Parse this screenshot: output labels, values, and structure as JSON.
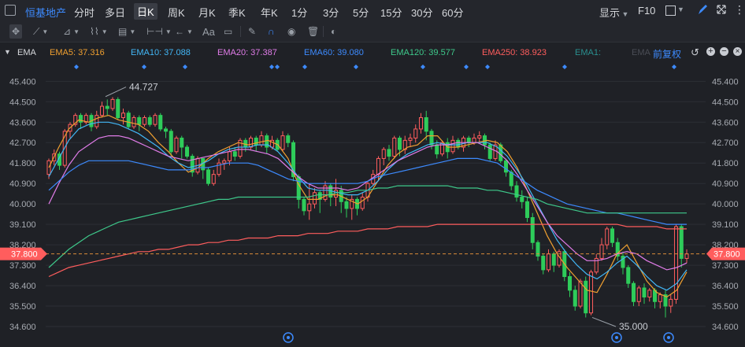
{
  "topbar": {
    "stock_name": "恒基地产",
    "periods": [
      "分时",
      "多日",
      "日K",
      "周K",
      "月K",
      "季K",
      "年K",
      "1分",
      "3分",
      "5分",
      "15分",
      "30分",
      "60分"
    ],
    "active_period": "日K",
    "display_label": "显示",
    "f10_label": "F10"
  },
  "toolbar": {
    "text_tool_label": "Aa"
  },
  "ema": {
    "name": "EMA",
    "items": [
      {
        "label": "EMA5: 37.316",
        "color": "#f0a030"
      },
      {
        "label": "EMA10: 37.088",
        "color": "#42b6f5"
      },
      {
        "label": "EMA20: 37.387",
        "color": "#e07ce8"
      },
      {
        "label": "EMA60: 39.080",
        "color": "#3d8bff"
      },
      {
        "label": "EMA120: 39.577",
        "color": "#3ec98b"
      },
      {
        "label": "EMA250: 38.923",
        "color": "#ff5d5d"
      },
      {
        "label": "EMA1:",
        "color": "#2a8f8f"
      },
      {
        "label": "EMA",
        "color": "#4a4d55"
      }
    ],
    "adjust_label": "前复权"
  },
  "chart_data": {
    "type": "candlestick",
    "ylim": [
      34.15,
      46.0
    ],
    "y_ticks": [
      "45.400",
      "44.500",
      "43.600",
      "42.700",
      "41.800",
      "40.900",
      "40.000",
      "39.100",
      "38.200",
      "37.300",
      "36.400",
      "35.500",
      "34.600"
    ],
    "y_tick_values": [
      45.4,
      44.5,
      43.6,
      42.7,
      41.8,
      40.9,
      40.0,
      39.1,
      38.2,
      37.3,
      36.4,
      35.5,
      34.6
    ],
    "current_price": "37.800",
    "current_price_value": 37.8,
    "high_annotation": "44.727",
    "low_annotation": "35.000",
    "up_color": "#ff5d5d",
    "down_color": "#2ecc5a",
    "candles": [
      [
        41.3,
        41.9,
        41.1,
        42.0
      ],
      [
        41.9,
        42.2,
        41.7,
        42.4
      ],
      [
        42.2,
        41.7,
        41.5,
        42.3
      ],
      [
        41.7,
        43.2,
        41.6,
        43.3
      ],
      [
        43.2,
        43.5,
        42.9,
        43.6
      ],
      [
        43.5,
        43.9,
        43.4,
        44.0
      ],
      [
        43.9,
        43.6,
        43.3,
        44.0
      ],
      [
        43.6,
        43.9,
        43.5,
        44.0
      ],
      [
        43.9,
        43.4,
        43.2,
        44.0
      ],
      [
        43.4,
        43.9,
        43.3,
        44.1
      ],
      [
        43.9,
        44.3,
        43.8,
        44.5
      ],
      [
        44.3,
        44.2,
        43.9,
        44.6
      ],
      [
        44.2,
        44.6,
        44.1,
        44.7
      ],
      [
        44.6,
        43.8,
        43.7,
        44.7
      ],
      [
        43.8,
        44.0,
        43.5,
        44.2
      ],
      [
        44.0,
        43.4,
        43.3,
        44.1
      ],
      [
        43.4,
        43.8,
        43.3,
        43.9
      ],
      [
        43.8,
        43.5,
        43.2,
        43.9
      ],
      [
        43.5,
        43.8,
        43.4,
        43.9
      ],
      [
        43.8,
        43.5,
        43.4,
        43.9
      ],
      [
        43.5,
        43.9,
        43.4,
        44.0
      ],
      [
        43.9,
        43.3,
        43.2,
        44.0
      ],
      [
        43.3,
        43.2,
        42.9,
        43.4
      ],
      [
        43.2,
        42.3,
        42.1,
        43.3
      ],
      [
        42.3,
        42.9,
        42.2,
        43.0
      ],
      [
        42.9,
        42.5,
        42.0,
        43.0
      ],
      [
        42.5,
        42.1,
        42.0,
        42.6
      ],
      [
        42.1,
        41.4,
        41.2,
        42.2
      ],
      [
        41.4,
        42.0,
        41.3,
        42.1
      ],
      [
        42.0,
        41.5,
        41.1,
        42.0
      ],
      [
        41.5,
        40.9,
        40.8,
        41.6
      ],
      [
        40.9,
        41.3,
        40.8,
        41.5
      ],
      [
        41.3,
        41.8,
        41.2,
        42.0
      ],
      [
        41.8,
        41.9,
        41.5,
        42.0
      ],
      [
        41.9,
        42.3,
        41.7,
        42.5
      ],
      [
        42.3,
        42.1,
        41.9,
        42.5
      ],
      [
        42.1,
        42.8,
        42.0,
        42.9
      ],
      [
        42.8,
        42.5,
        42.3,
        42.9
      ],
      [
        42.5,
        42.9,
        42.4,
        43.0
      ],
      [
        42.9,
        42.6,
        42.3,
        43.0
      ],
      [
        42.6,
        43.0,
        42.5,
        43.2
      ],
      [
        43.0,
        42.5,
        42.2,
        43.1
      ],
      [
        42.5,
        42.8,
        42.4,
        43.0
      ],
      [
        42.8,
        42.4,
        42.3,
        42.9
      ],
      [
        42.4,
        43.0,
        42.3,
        43.2
      ],
      [
        43.0,
        42.7,
        42.5,
        43.1
      ],
      [
        42.7,
        41.2,
        41.0,
        42.8
      ],
      [
        41.2,
        40.2,
        39.8,
        41.3
      ],
      [
        40.2,
        39.7,
        39.5,
        40.3
      ],
      [
        39.7,
        40.0,
        39.3,
        40.9
      ],
      [
        40.0,
        40.5,
        39.8,
        40.7
      ],
      [
        40.5,
        40.2,
        39.6,
        40.6
      ],
      [
        40.2,
        40.8,
        40.1,
        41.0
      ],
      [
        40.8,
        40.3,
        39.9,
        40.9
      ],
      [
        40.3,
        40.6,
        39.9,
        41.1
      ],
      [
        40.6,
        40.1,
        39.6,
        40.8
      ],
      [
        40.1,
        39.8,
        39.4,
        40.3
      ],
      [
        39.8,
        40.2,
        39.3,
        40.4
      ],
      [
        40.2,
        39.8,
        39.5,
        40.3
      ],
      [
        39.8,
        40.3,
        39.7,
        40.5
      ],
      [
        40.3,
        40.9,
        40.1,
        41.0
      ],
      [
        40.9,
        41.3,
        40.8,
        41.5
      ],
      [
        41.3,
        42.0,
        41.0,
        42.1
      ],
      [
        42.0,
        42.4,
        41.7,
        42.5
      ],
      [
        42.4,
        42.1,
        41.9,
        42.6
      ],
      [
        42.1,
        42.9,
        42.0,
        43.0
      ],
      [
        42.9,
        42.4,
        42.1,
        43.0
      ],
      [
        42.4,
        42.8,
        42.2,
        43.0
      ],
      [
        42.8,
        42.9,
        42.5,
        43.1
      ],
      [
        42.9,
        43.3,
        42.7,
        43.5
      ],
      [
        43.3,
        43.8,
        43.1,
        44.0
      ],
      [
        43.8,
        43.2,
        42.8,
        44.1
      ],
      [
        43.2,
        42.6,
        42.4,
        43.3
      ],
      [
        42.6,
        42.2,
        42.0,
        42.8
      ],
      [
        42.2,
        42.7,
        42.1,
        42.8
      ],
      [
        42.7,
        42.3,
        42.0,
        42.9
      ],
      [
        42.3,
        42.8,
        42.2,
        43.0
      ],
      [
        42.8,
        42.5,
        42.4,
        42.9
      ],
      [
        42.5,
        42.9,
        42.3,
        43.0
      ],
      [
        42.9,
        42.7,
        42.5,
        43.0
      ],
      [
        42.7,
        42.9,
        42.6,
        43.1
      ],
      [
        42.9,
        43.0,
        42.7,
        43.2
      ],
      [
        43.0,
        42.6,
        42.4,
        43.1
      ],
      [
        42.6,
        42.0,
        41.9,
        42.7
      ],
      [
        42.0,
        42.6,
        41.9,
        42.8
      ],
      [
        42.6,
        41.9,
        41.8,
        42.7
      ],
      [
        41.9,
        41.4,
        41.2,
        42.0
      ],
      [
        41.4,
        40.8,
        40.6,
        41.5
      ],
      [
        40.8,
        40.3,
        40.1,
        41.0
      ],
      [
        40.3,
        40.1,
        39.8,
        40.6
      ],
      [
        40.1,
        39.4,
        39.2,
        40.3
      ],
      [
        39.4,
        38.3,
        38.0,
        39.6
      ],
      [
        38.3,
        37.7,
        37.5,
        38.4
      ],
      [
        37.7,
        37.1,
        36.9,
        37.8
      ],
      [
        37.1,
        37.8,
        37.0,
        38.0
      ],
      [
        37.8,
        37.3,
        37.0,
        37.9
      ],
      [
        37.3,
        37.9,
        37.2,
        38.0
      ],
      [
        37.9,
        36.8,
        36.6,
        38.0
      ],
      [
        36.8,
        36.2,
        35.9,
        37.0
      ],
      [
        36.2,
        35.5,
        35.3,
        36.4
      ],
      [
        35.5,
        36.6,
        35.4,
        36.7
      ],
      [
        36.6,
        35.2,
        35.0,
        36.8
      ],
      [
        35.2,
        37.0,
        35.1,
        37.1
      ],
      [
        37.0,
        37.6,
        36.9,
        37.8
      ],
      [
        37.6,
        38.2,
        37.5,
        38.5
      ],
      [
        38.2,
        38.9,
        38.0,
        39.0
      ],
      [
        38.9,
        38.3,
        38.1,
        39.0
      ],
      [
        38.3,
        37.7,
        37.5,
        38.5
      ],
      [
        37.7,
        37.2,
        36.9,
        37.9
      ],
      [
        37.2,
        36.5,
        36.3,
        37.3
      ],
      [
        36.5,
        35.7,
        35.5,
        36.6
      ],
      [
        35.7,
        36.3,
        35.5,
        36.4
      ],
      [
        36.3,
        35.9,
        35.6,
        36.5
      ],
      [
        35.9,
        36.2,
        35.7,
        36.3
      ],
      [
        36.2,
        35.7,
        35.4,
        36.3
      ],
      [
        35.7,
        36.0,
        35.4,
        36.1
      ],
      [
        36.0,
        35.5,
        35.0,
        36.2
      ],
      [
        35.5,
        35.8,
        35.2,
        36.0
      ],
      [
        35.8,
        39.0,
        35.6,
        39.1
      ],
      [
        39.0,
        37.6,
        37.2,
        39.1
      ],
      [
        37.6,
        37.8,
        37.4,
        38.0
      ]
    ],
    "ema_lines": [
      {
        "name": "EMA5",
        "color": "#f0a030",
        "values": [
          41.6,
          42.5,
          43.3,
          43.7,
          43.6,
          43.8,
          43.9,
          43.7,
          43.6,
          43.5,
          43.2,
          42.7,
          42.3,
          41.8,
          41.4,
          41.6,
          42.0,
          42.3,
          42.5,
          42.7,
          42.6,
          42.7,
          42.8,
          42.6,
          42.0,
          40.9,
          40.2,
          40.2,
          40.4,
          40.4,
          40.2,
          40.0,
          40.3,
          41.0,
          41.7,
          42.2,
          42.5,
          42.6,
          43.0,
          43.0,
          42.5,
          42.5,
          42.6,
          42.7,
          42.8,
          42.7,
          42.3,
          41.6,
          40.6,
          39.6,
          38.6,
          37.8,
          37.2,
          36.7,
          36.2,
          36.1,
          36.9,
          37.8,
          38.2,
          37.4,
          36.6,
          36.1,
          35.9,
          36.2,
          37.0
        ]
      },
      {
        "name": "EMA10",
        "color": "#42b6f5",
        "values": [
          41.2,
          42.0,
          42.8,
          43.3,
          43.5,
          43.6,
          43.6,
          43.5,
          43.3,
          43.1,
          42.8,
          42.5,
          42.1,
          41.8,
          41.6,
          41.7,
          41.9,
          42.2,
          42.4,
          42.5,
          42.5,
          42.6,
          42.6,
          42.3,
          41.8,
          41.2,
          40.7,
          40.6,
          40.6,
          40.5,
          40.4,
          40.4,
          40.6,
          41.0,
          41.5,
          41.9,
          42.2,
          42.4,
          42.6,
          42.7,
          42.6,
          42.6,
          42.7,
          42.7,
          42.7,
          42.5,
          42.1,
          41.5,
          40.8,
          40.0,
          39.2,
          38.4,
          37.8,
          37.3,
          36.9,
          36.7,
          37.0,
          37.4,
          37.7,
          37.3,
          36.8,
          36.4,
          36.2,
          36.5,
          37.1
        ]
      },
      {
        "name": "EMA20",
        "color": "#e07ce8",
        "values": [
          40.0,
          40.9,
          41.7,
          42.3,
          42.6,
          42.9,
          43.0,
          43.0,
          42.9,
          42.7,
          42.5,
          42.3,
          42.1,
          42.0,
          41.9,
          42.0,
          42.1,
          42.2,
          42.3,
          42.4,
          42.4,
          42.3,
          42.2,
          42.0,
          41.6,
          41.2,
          40.9,
          40.7,
          40.7,
          40.7,
          40.6,
          40.7,
          41.0,
          41.3,
          41.6,
          41.9,
          42.1,
          42.3,
          42.5,
          42.6,
          42.6,
          42.7,
          42.7,
          42.7,
          42.5,
          42.3,
          41.9,
          41.3,
          40.6,
          39.9,
          39.2,
          38.6,
          38.2,
          37.8,
          37.5,
          37.5,
          37.6,
          37.8,
          37.9,
          37.8,
          37.5,
          37.3,
          37.1,
          37.2,
          37.4
        ]
      },
      {
        "name": "EMA60",
        "color": "#3d8bff",
        "values": [
          40.6,
          41.0,
          41.4,
          41.7,
          41.9,
          41.9,
          41.9,
          41.9,
          41.9,
          41.8,
          41.7,
          41.6,
          41.5,
          41.5,
          41.5,
          41.6,
          41.6,
          41.7,
          41.8,
          41.8,
          41.8,
          41.7,
          41.5,
          41.3,
          41.1,
          41.0,
          40.9,
          40.9,
          40.9,
          40.9,
          40.9,
          40.9,
          41.0,
          41.2,
          41.3,
          41.4,
          41.5,
          41.6,
          41.7,
          41.8,
          41.9,
          42.0,
          42.0,
          42.0,
          41.9,
          41.8,
          41.5,
          41.2,
          40.9,
          40.6,
          40.4,
          40.2,
          40.0,
          39.9,
          39.8,
          39.7,
          39.6,
          39.6,
          39.5,
          39.4,
          39.3,
          39.2,
          39.1,
          39.1,
          39.1
        ]
      },
      {
        "name": "EMA120",
        "color": "#3ec98b",
        "values": [
          37.2,
          37.6,
          38.0,
          38.3,
          38.6,
          38.8,
          39.0,
          39.2,
          39.3,
          39.4,
          39.5,
          39.6,
          39.7,
          39.8,
          39.9,
          40.0,
          40.1,
          40.2,
          40.2,
          40.3,
          40.3,
          40.3,
          40.3,
          40.3,
          40.3,
          40.3,
          40.3,
          40.4,
          40.4,
          40.5,
          40.5,
          40.6,
          40.6,
          40.7,
          40.7,
          40.8,
          40.8,
          40.8,
          40.8,
          40.8,
          40.8,
          40.7,
          40.7,
          40.7,
          40.6,
          40.6,
          40.5,
          40.4,
          40.3,
          40.2,
          40.0,
          39.9,
          39.8,
          39.7,
          39.6,
          39.6,
          39.6,
          39.6,
          39.6,
          39.6,
          39.6,
          39.6,
          39.6,
          39.6,
          39.6
        ]
      },
      {
        "name": "EMA250",
        "color": "#ff5d5d",
        "values": [
          36.8,
          37.0,
          37.2,
          37.3,
          37.4,
          37.5,
          37.6,
          37.7,
          37.8,
          37.9,
          37.9,
          38.0,
          38.0,
          38.1,
          38.2,
          38.2,
          38.3,
          38.3,
          38.4,
          38.4,
          38.5,
          38.5,
          38.5,
          38.6,
          38.6,
          38.6,
          38.7,
          38.7,
          38.7,
          38.8,
          38.8,
          38.8,
          38.9,
          38.9,
          38.9,
          39.0,
          39.0,
          39.0,
          39.0,
          39.1,
          39.1,
          39.1,
          39.1,
          39.1,
          39.1,
          39.1,
          39.1,
          39.1,
          39.1,
          39.1,
          39.1,
          39.1,
          39.1,
          39.1,
          39.1,
          39.1,
          39.1,
          39.1,
          39.0,
          39.0,
          39.0,
          39.0,
          38.9,
          38.9,
          38.9
        ]
      }
    ]
  }
}
